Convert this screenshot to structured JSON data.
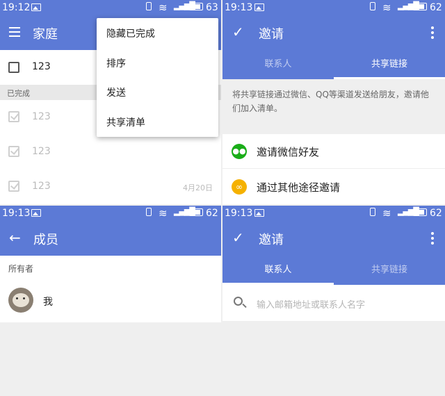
{
  "panel1": {
    "status": {
      "time": "19:12",
      "battery": "63"
    },
    "title": "家庭",
    "todo": [
      {
        "text": "123"
      }
    ],
    "section_label": "已完成",
    "completed": [
      {
        "text": "123",
        "date": ""
      },
      {
        "text": "123",
        "date": ""
      },
      {
        "text": "123",
        "date": "4月20日"
      }
    ],
    "menu": {
      "items": [
        "隐藏已完成",
        "排序",
        "发送",
        "共享清单"
      ]
    }
  },
  "panel2": {
    "status": {
      "time": "19:13",
      "battery": "62"
    },
    "title": "邀请",
    "tabs": [
      "联系人",
      "共享链接"
    ],
    "active_tab": 1,
    "description": "将共享链接通过微信、QQ等渠道发送给朋友，邀请他们加入清单。",
    "options": [
      {
        "label": "邀请微信好友",
        "icon": "wechat-icon"
      },
      {
        "label": "通过其他途径邀请",
        "icon": "link-icon"
      }
    ]
  },
  "panel3": {
    "status": {
      "time": "19:13",
      "battery": "62"
    },
    "title": "成员",
    "section_label": "所有者",
    "member": {
      "name": "我"
    }
  },
  "panel4": {
    "status": {
      "time": "19:13",
      "battery": "62"
    },
    "title": "邀请",
    "tabs": [
      "联系人",
      "共享链接"
    ],
    "active_tab": 0,
    "search": {
      "placeholder": "输入邮箱地址或联系人名字"
    }
  },
  "colors": {
    "accent": "#5c7ad6",
    "background": "#efefef",
    "wechat": "#1aad19",
    "link": "#f5b100"
  }
}
